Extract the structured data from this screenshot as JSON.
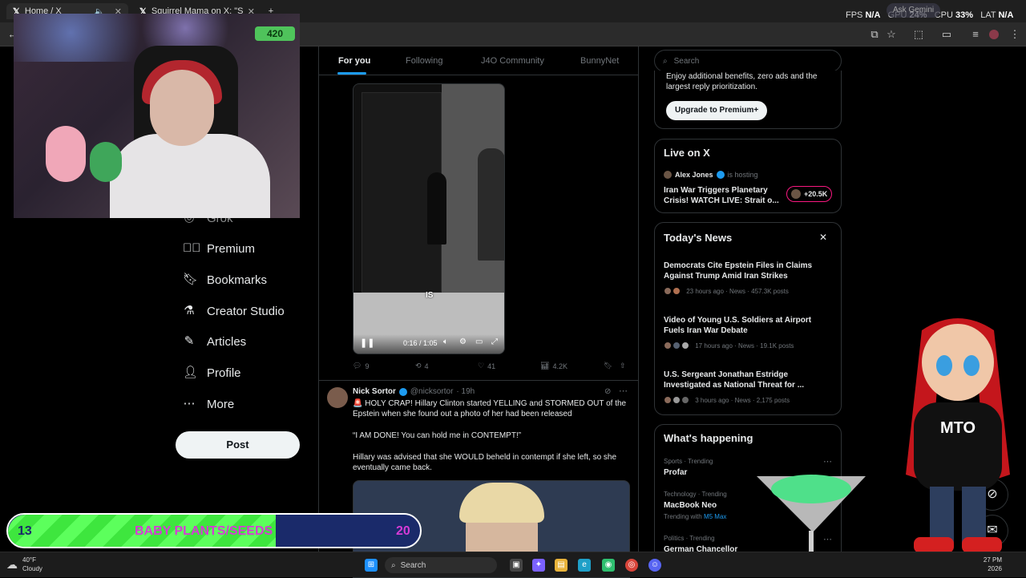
{
  "browser": {
    "tabs": [
      {
        "title": "Home / X",
        "active": true
      },
      {
        "title": "Squirrel Mama on X: \"She alw",
        "active": false
      }
    ],
    "new_tab": "+",
    "stats": {
      "fps_label": "FPS",
      "fps_value": "N/A",
      "gpu_label": "GPU",
      "gpu_value": "24",
      "gpu_unit": "%",
      "cpu_label": "CPU",
      "cpu_value": "33",
      "cpu_unit": "%",
      "lat_label": "LAT",
      "lat_value": "N/A"
    },
    "gemini": "Ask Gemini"
  },
  "webcam": {
    "sign": "420"
  },
  "left_nav": {
    "items": [
      {
        "label": "Grok",
        "icon": "grok-icon"
      },
      {
        "label": "Premium",
        "icon": "premium-icon"
      },
      {
        "label": "Bookmarks",
        "icon": "bookmark-icon"
      },
      {
        "label": "Creator Studio",
        "icon": "creator-studio-icon"
      },
      {
        "label": "Articles",
        "icon": "articles-icon"
      },
      {
        "label": "Profile",
        "icon": "profile-icon"
      },
      {
        "label": "More",
        "icon": "more-icon"
      }
    ],
    "post_label": "Post"
  },
  "feed": {
    "tabs": [
      "For you",
      "Following",
      "J4O Community",
      "BunnyNet"
    ],
    "active_tab": "For you",
    "video": {
      "caption": "IS",
      "time": "0:16 / 1:05"
    },
    "tweet1_actions": {
      "replies": "9",
      "reposts": "4",
      "likes": "41",
      "views": "4.2K"
    },
    "tweet2": {
      "name": "Nick Sortor",
      "handle": "@nicksortor",
      "age": "· 19h",
      "line1": "🚨 HOLY CRAP! Hillary Clinton started YELLING and STORMED OUT of the Epstein when she found out a photo of her had been released",
      "line2": "“I AM DONE! You can hold me in CONTEMPT!”",
      "line3": "Hillary was advised that she WOULD beheld in contempt if she left, so she eventually came back."
    }
  },
  "right": {
    "search_placeholder": "Search",
    "premium": {
      "text_line1": "Enjoy additional benefits, zero ads and the",
      "text_line2": "largest reply prioritization.",
      "button": "Upgrade to Premium+"
    },
    "live": {
      "title": "Live on X",
      "host": "Alex Jones",
      "hosting": "is hosting",
      "headline": "Iran War Triggers Planetary Crisis! WATCH LIVE: Strait o...",
      "count": "+20.5K"
    },
    "news": {
      "title": "Today's News",
      "items": [
        {
          "headline": "Democrats Cite Epstein Files in Claims Against Trump Amid Iran Strikes",
          "meta": "23 hours ago · News · 457.3K posts"
        },
        {
          "headline": "Video of Young U.S. Soldiers at Airport Fuels Iran War Debate",
          "meta": "17 hours ago · News · 19.1K posts"
        },
        {
          "headline": "U.S. Sergeant Jonathan Estridge Investigated as National Threat for ...",
          "meta": "3 hours ago · News · 2,175 posts"
        }
      ]
    },
    "happening": {
      "title": "What's happening",
      "items": [
        {
          "category": "Sports · Trending",
          "name": "Profar",
          "extra": ""
        },
        {
          "category": "Technology · Trending",
          "name": "MacBook Neo",
          "extra": "Trending with",
          "extra_link": "M5 Max"
        },
        {
          "category": "Politics · Trending",
          "name": "German Chancellor",
          "extra": ""
        }
      ]
    }
  },
  "overlay": {
    "goal_current": "13",
    "goal_label": "BABY PLANTS/SEEDS",
    "goal_target": "20",
    "goal_progress": 0.65,
    "avatar_text": "MTO"
  },
  "taskbar": {
    "weather_temp": "40°F",
    "weather_desc": "Cloudy",
    "search": "Search",
    "time": "27 PM",
    "date": "2026"
  },
  "colors": {
    "accent": "#1d9bf0",
    "goal_fill": "#5cff5c",
    "goal_text": "#d63bd6",
    "background": "#000000"
  }
}
